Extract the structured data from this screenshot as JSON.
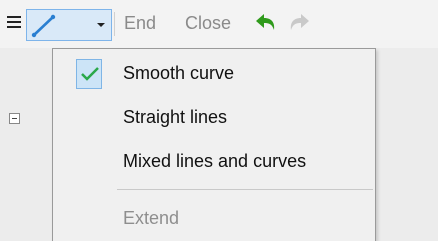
{
  "toolbar": {
    "end_label": "End",
    "close_label": "Close",
    "accent_color": "#7eb4ea"
  },
  "menu": {
    "items": [
      {
        "label": "Smooth curve",
        "checked": true
      },
      {
        "label": "Straight lines"
      },
      {
        "label": "Mixed lines and curves"
      },
      {
        "label": "Extend",
        "disabled": true
      }
    ]
  }
}
